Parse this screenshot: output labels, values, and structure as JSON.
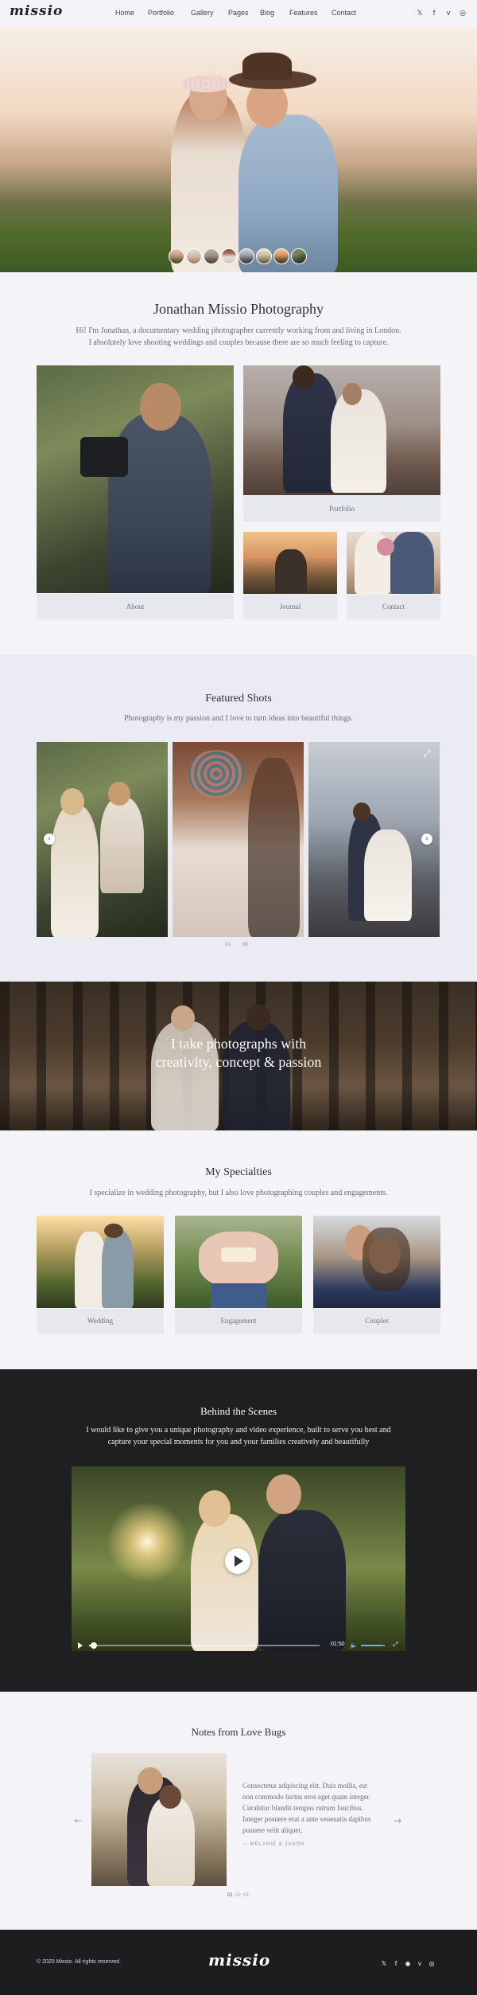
{
  "header": {
    "logo": "missio",
    "nav": [
      "Home",
      "Portfolio",
      "Gallery",
      "Pages",
      "Blog",
      "Features",
      "Contact"
    ],
    "social_icons": [
      "twitter-icon",
      "facebook-icon",
      "vimeo-icon",
      "instagram-icon"
    ],
    "social_glyphs": [
      "𝕏",
      "f",
      "v",
      "◎"
    ]
  },
  "intro": {
    "title": "Jonathan Missio Photography",
    "text_line1": "Hi! I'm Jonathan, a documentary wedding photographer currently working from and living in London.",
    "text_line2": "I absolutely love shooting weddings and couples because there are so much feeling to capture.",
    "tiles": {
      "about": "About",
      "portfolio": "Portfolio",
      "journal": "Journal",
      "contact": "Contact"
    }
  },
  "featured": {
    "title": "Featured Shots",
    "subtitle": "Photography is my passion and I love to turn ideas into beautiful things.",
    "counter_current": "01",
    "counter_total": "08"
  },
  "banner": {
    "line1": "I take photographs with",
    "line2": "creativity, concept & passion"
  },
  "specialties": {
    "title": "My Specialties",
    "subtitle": "I specialize in wedding photography, but I also love photographing couples and engagements.",
    "items": [
      "Wedding",
      "Engagement",
      "Couples"
    ]
  },
  "behind": {
    "title": "Behind the Scenes",
    "text_line1": "I would like to give you a unique photography and video experience, built to serve you best and",
    "text_line2": "capture your special moments for you and your families creatively and beautifully",
    "video_time": "01:50",
    "progress": 0.02,
    "volume": 0.85
  },
  "notes": {
    "title": "Notes from Love Bugs",
    "quote_lines": [
      "Consectetur adipiscing elit. Duis mollis, est",
      "non commodo luctus eros eget quam integer.",
      "Curabitur blandit tempus rutrum faucibus.",
      "Integer posuere erat a ante venenatis dapibus",
      "posuere velit aliquet."
    ],
    "author": "— MELANIE & JASON",
    "pager": [
      "01",
      "02",
      "03"
    ]
  },
  "footer": {
    "copyright": "© 2020 Missio. All rights reserved.",
    "logo": "missio",
    "social_glyphs": [
      "𝕏",
      "f",
      "◉",
      "v",
      "◎"
    ],
    "social_icons": [
      "twitter-icon",
      "facebook-icon",
      "pinterest-icon",
      "vimeo-icon",
      "instagram-icon"
    ]
  }
}
